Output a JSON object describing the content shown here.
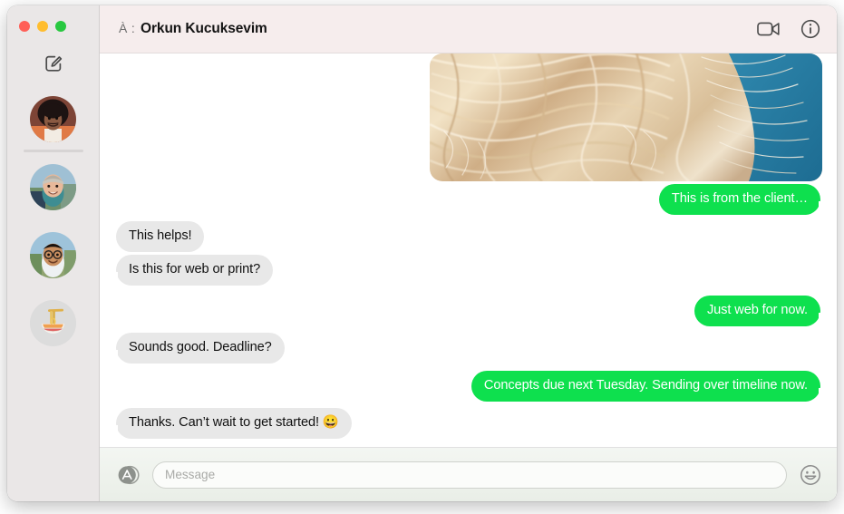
{
  "window": {
    "traffic_lights": [
      {
        "name": "close",
        "color": "#ff5f57"
      },
      {
        "name": "minimize",
        "color": "#ffbd2e"
      },
      {
        "name": "maximize",
        "color": "#28c840"
      }
    ]
  },
  "sidebar": {
    "compose_icon": "compose-pencil-square-icon",
    "conversations": [
      {
        "name": "conversation-avatar-1",
        "kind": "photo",
        "description": "person with afro hair",
        "bg": "#6b3a2e"
      },
      {
        "name": "conversation-avatar-2",
        "kind": "photo",
        "description": "person wearing grey beanie outdoors",
        "bg": "#8fa8b8"
      },
      {
        "name": "conversation-avatar-3",
        "kind": "photo",
        "description": "person with glasses outdoors",
        "bg": "#7f9bb0"
      },
      {
        "name": "conversation-avatar-4",
        "kind": "emoji",
        "description": "bowl of noodles",
        "emoji": "🍜",
        "bg": "#dcdcdc"
      }
    ]
  },
  "header": {
    "to_label": "À :",
    "contact_name": "Orkun Kucuksevim",
    "facetime_icon": "video-camera-icon",
    "info_icon": "info-circle-icon"
  },
  "conversation": {
    "attachment": {
      "name": "photo-attachment",
      "description": "close-up photo of blonde hair against a blue background"
    },
    "messages": [
      {
        "id": "m1",
        "direction": "outgoing",
        "text": "This is from the client…",
        "tail": true
      },
      {
        "id": "m2",
        "direction": "incoming",
        "text": "This helps!",
        "tail": false
      },
      {
        "id": "m3",
        "direction": "incoming",
        "text": "Is this for web or print?",
        "tail": true
      },
      {
        "id": "m4",
        "direction": "outgoing",
        "text": "Just web for now.",
        "tail": true
      },
      {
        "id": "m5",
        "direction": "incoming",
        "text": "Sounds good. Deadline?",
        "tail": true
      },
      {
        "id": "m6",
        "direction": "outgoing",
        "text": "Concepts due next Tuesday. Sending over timeline now.",
        "tail": true
      },
      {
        "id": "m7",
        "direction": "incoming",
        "text": "Thanks. Can’t wait to get started! 😀",
        "tail": true
      }
    ]
  },
  "compose": {
    "appstore_icon": "app-store-icon",
    "input_placeholder": "Message",
    "input_value": "",
    "emoji_icon": "smiley-face-icon"
  },
  "colors": {
    "outgoing_bubble": "#0ee04e",
    "incoming_bubble": "#e8e8e8",
    "sidebar_bg": "#eae7e7",
    "header_bg": "#f6eded"
  }
}
